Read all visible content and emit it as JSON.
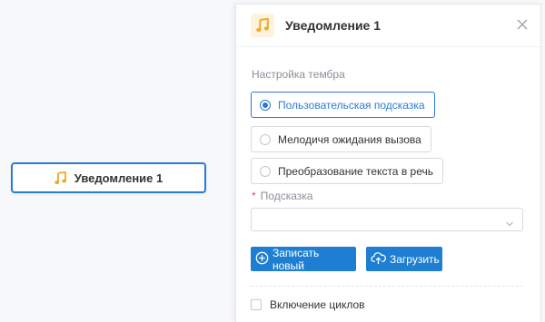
{
  "canvas": {
    "node": {
      "label": "Уведомление 1",
      "icon": "music-note-icon"
    }
  },
  "panel": {
    "title": "Уведомление 1",
    "header_icon": "music-note-icon",
    "close_icon": "close-icon",
    "tone_section_label": "Настройка тембра",
    "tone_options": [
      {
        "label": "Пользовательская подсказка",
        "selected": true
      },
      {
        "label": "Мелодичя ожидания вызова",
        "selected": false
      },
      {
        "label": "Преобразование текста в речь",
        "selected": false
      }
    ],
    "prompt_field": {
      "required_mark": "*",
      "label": "Подсказка",
      "value": ""
    },
    "record_button": {
      "label": "Записать новый",
      "icon": "plus-circle-icon"
    },
    "upload_button": {
      "label": "Загрузить",
      "icon": "cloud-upload-icon"
    },
    "loop_checkbox": {
      "label": "Включение циклов",
      "checked": false
    }
  },
  "colors": {
    "accent": "#1e7fd2",
    "selected_border": "#2b7bd6",
    "icon_orange": "#f5a623",
    "icon_bg": "#fdf3dc",
    "required": "#e84a4a"
  }
}
